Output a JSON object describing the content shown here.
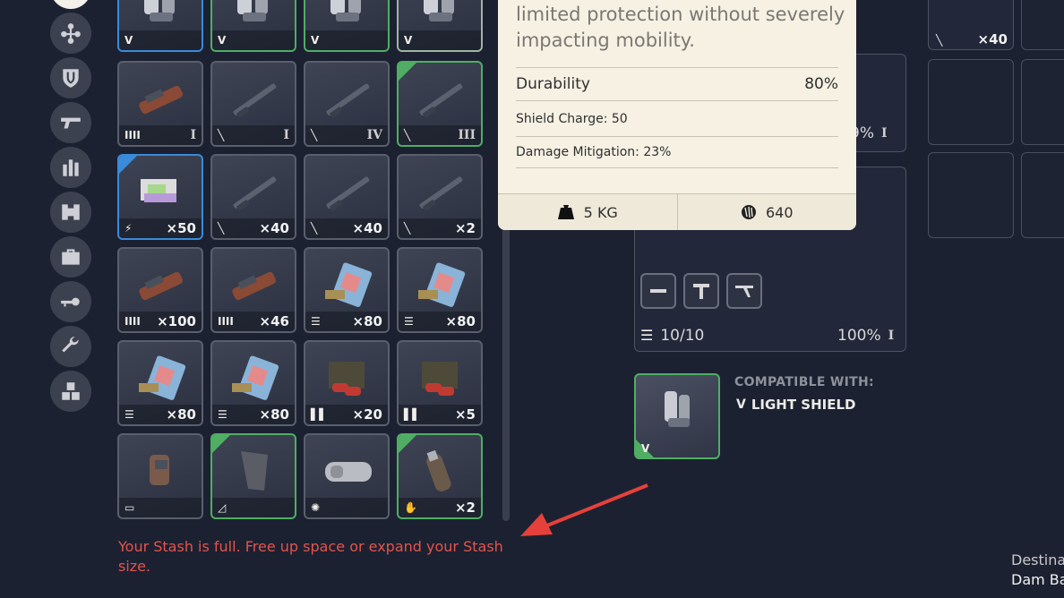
{
  "sidebar": {
    "categories": [
      {
        "name": "all-category",
        "icon": "circle-icon"
      },
      {
        "name": "augments-category",
        "icon": "augment-icon"
      },
      {
        "name": "shields-category",
        "icon": "shield-icon"
      },
      {
        "name": "weapons-category",
        "icon": "gun-icon"
      },
      {
        "name": "ammo-category",
        "icon": "ammo-icon"
      },
      {
        "name": "mods-category",
        "icon": "mod-icon"
      },
      {
        "name": "utilities-category",
        "icon": "toolbox-icon"
      },
      {
        "name": "keys-category",
        "icon": "key-icon"
      },
      {
        "name": "materials-category",
        "icon": "wrench-icon"
      },
      {
        "name": "misc-category",
        "icon": "blocks-icon"
      }
    ]
  },
  "stash": {
    "rows": [
      [
        {
          "rarity": "blue",
          "icon": "shield-icon",
          "badge": "Ⅴ",
          "count": "",
          "tier": ""
        },
        {
          "rarity": "green",
          "icon": "shield-icon",
          "badge": "Ⅴ",
          "count": "",
          "tier": ""
        },
        {
          "rarity": "green",
          "icon": "shield-icon",
          "badge": "Ⅴ",
          "count": "",
          "tier": ""
        },
        {
          "rarity": "lgreen",
          "icon": "shield-icon",
          "badge": "Ⅴ",
          "count": "",
          "tier": ""
        }
      ],
      [
        {
          "rarity": "none",
          "icon": "heavy-ammo-icon",
          "badge": "IIII",
          "count": "",
          "tier": "I"
        },
        {
          "rarity": "none",
          "icon": "light-ammo-icon",
          "badge": "╲",
          "count": "",
          "tier": "I"
        },
        {
          "rarity": "none",
          "icon": "light-ammo-icon",
          "badge": "╲",
          "count": "",
          "tier": "IV"
        },
        {
          "rarity": "green",
          "icon": "light-ammo-icon",
          "badge": "╲",
          "count": "",
          "tier": "III"
        }
      ],
      [
        {
          "rarity": "blue",
          "icon": "energy-icon",
          "badge": "⚡",
          "count": "×50",
          "tier": ""
        },
        {
          "rarity": "none",
          "icon": "light-ammo-icon",
          "badge": "╲",
          "count": "×40",
          "tier": ""
        },
        {
          "rarity": "none",
          "icon": "light-ammo-icon",
          "badge": "╲",
          "count": "×40",
          "tier": ""
        },
        {
          "rarity": "none",
          "icon": "light-ammo-icon",
          "badge": "╲",
          "count": "×2",
          "tier": ""
        }
      ],
      [
        {
          "rarity": "none",
          "icon": "heavy-ammo-icon",
          "badge": "IIII",
          "count": "×100",
          "tier": ""
        },
        {
          "rarity": "none",
          "icon": "heavy-ammo-icon",
          "badge": "IIII",
          "count": "×46",
          "tier": ""
        },
        {
          "rarity": "none",
          "icon": "medium-ammo-icon",
          "badge": "☰",
          "count": "×80",
          "tier": ""
        },
        {
          "rarity": "none",
          "icon": "medium-ammo-icon",
          "badge": "☰",
          "count": "×80",
          "tier": ""
        }
      ],
      [
        {
          "rarity": "none",
          "icon": "medium-ammo-icon",
          "badge": "☰",
          "count": "×80",
          "tier": ""
        },
        {
          "rarity": "none",
          "icon": "medium-ammo-icon",
          "badge": "☰",
          "count": "×80",
          "tier": ""
        },
        {
          "rarity": "none",
          "icon": "shotgun-ammo-icon",
          "badge": "▌▌",
          "count": "×20",
          "tier": ""
        },
        {
          "rarity": "none",
          "icon": "shotgun-ammo-icon",
          "badge": "▌▌",
          "count": "×5",
          "tier": ""
        }
      ],
      [
        {
          "rarity": "none",
          "icon": "mod-icon",
          "badge": "▭",
          "count": "",
          "tier": ""
        },
        {
          "rarity": "green",
          "icon": "stock-icon",
          "badge": "◿",
          "count": "",
          "tier": ""
        },
        {
          "rarity": "none",
          "icon": "material-icon",
          "badge": "✺",
          "count": "",
          "tier": ""
        },
        {
          "rarity": "green",
          "icon": "grenade-icon",
          "badge": "✋",
          "count": "×2",
          "tier": ""
        }
      ]
    ]
  },
  "tooltip": {
    "description": "limited protection without severely impacting mobility.",
    "durability_label": "Durability",
    "durability_value": "80%",
    "shield_charge": "Shield Charge: 50",
    "damage_mitigation": "Damage Mitigation: 23%",
    "weight": "5 KG",
    "value": "640"
  },
  "right_panel": {
    "top_count": "×40",
    "weapon1_durability": "9%",
    "weapon2_ammo": "10/10",
    "weapon2_durability": "100%",
    "compatible_label": "COMPATIBLE WITH:",
    "compatible_item": "LIGHT SHIELD"
  },
  "warning": {
    "message": "Your Stash is full. Free up space or expand your Stash size."
  },
  "destination": {
    "label": "Destina",
    "place": "Dam Ba"
  },
  "colors": {
    "background": "#1c2131",
    "rarity_blue": "#3a8bd9",
    "rarity_green": "#4fae63",
    "warning_red": "#e5534b",
    "tooltip_bg": "#f6f1e3"
  }
}
